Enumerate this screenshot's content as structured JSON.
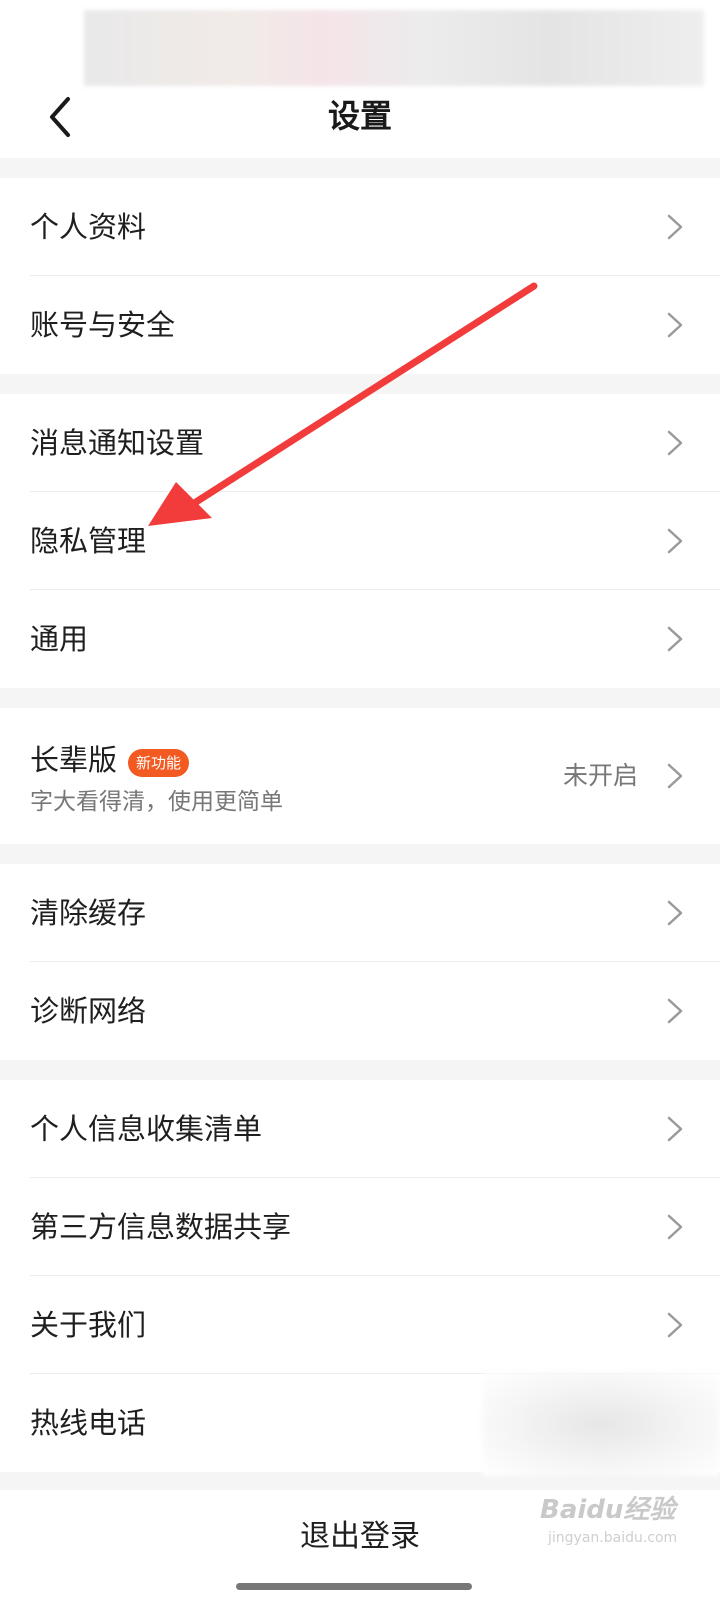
{
  "header": {
    "title": "设置",
    "back_icon": "chevron-left-icon"
  },
  "groups": [
    {
      "items": [
        {
          "label": "个人资料"
        },
        {
          "label": "账号与安全"
        }
      ]
    },
    {
      "items": [
        {
          "label": "消息通知设置"
        },
        {
          "label": "隐私管理"
        },
        {
          "label": "通用"
        }
      ]
    },
    {
      "elder": {
        "title": "长辈版",
        "badge": "新功能",
        "subtitle": "字大看得清，使用更简单",
        "status": "未开启"
      }
    },
    {
      "items": [
        {
          "label": "清除缓存"
        },
        {
          "label": "诊断网络"
        }
      ]
    },
    {
      "items": [
        {
          "label": "个人信息收集清单"
        },
        {
          "label": "第三方信息数据共享"
        },
        {
          "label": "关于我们"
        },
        {
          "label": "热线电话"
        }
      ]
    }
  ],
  "logout": {
    "label": "退出登录"
  },
  "watermark": {
    "brand": "Baidu经验",
    "sub": "jingyan.baidu.com"
  },
  "colors": {
    "accent_badge": "#f25a22",
    "annotation_arrow": "#f23c3c",
    "background": "#f5f5f5"
  }
}
